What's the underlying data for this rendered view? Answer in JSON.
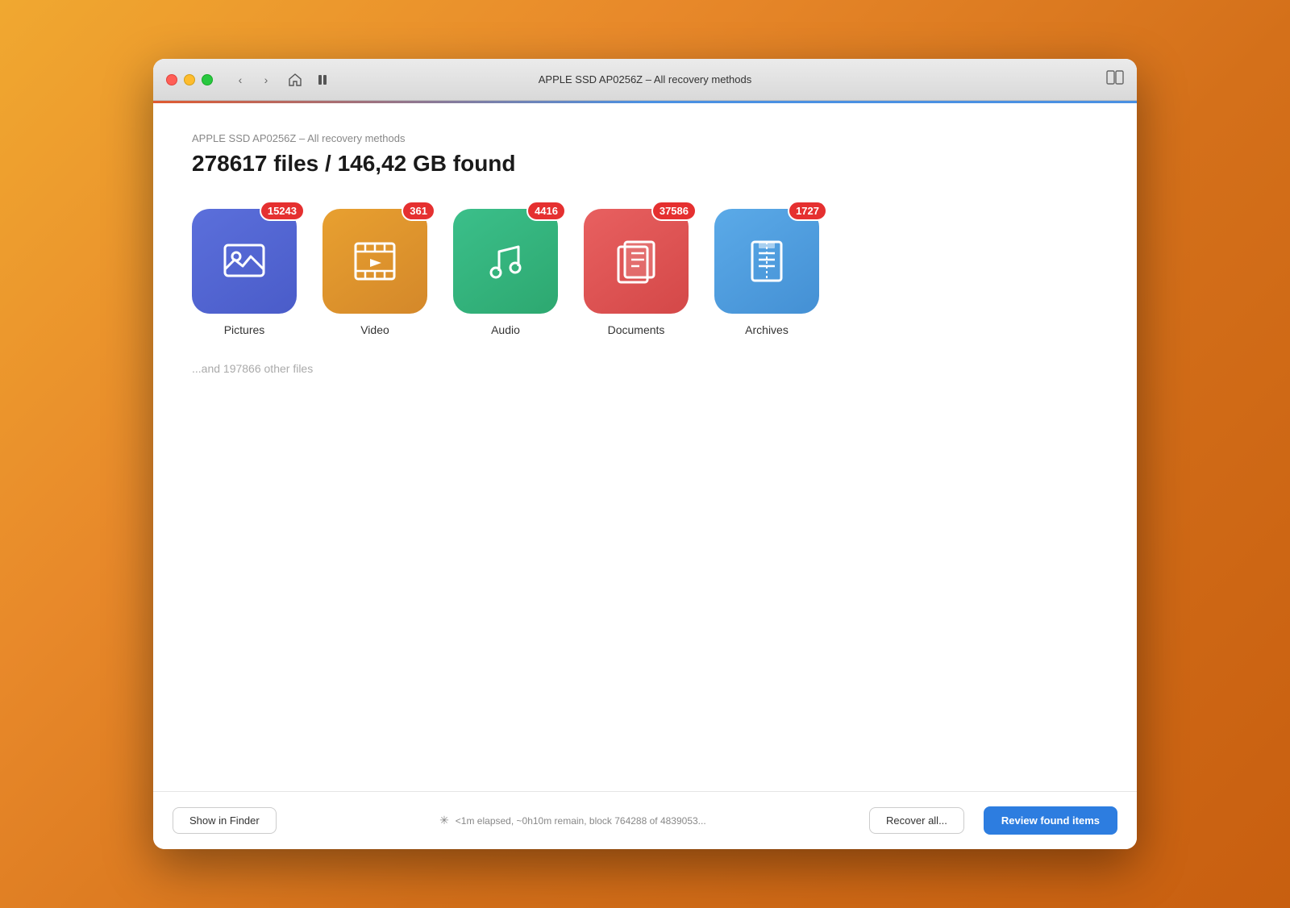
{
  "window": {
    "title": "APPLE SSD AP0256Z – All recovery methods",
    "breadcrumb": "APPLE SSD AP0256Z – All recovery methods",
    "main_title": "278617 files / 146,42 GB found"
  },
  "file_types": [
    {
      "id": "pictures",
      "label": "Pictures",
      "count": "15243",
      "color_class": "pictures"
    },
    {
      "id": "video",
      "label": "Video",
      "count": "361",
      "color_class": "video"
    },
    {
      "id": "audio",
      "label": "Audio",
      "count": "4416",
      "color_class": "audio"
    },
    {
      "id": "documents",
      "label": "Documents",
      "count": "37586",
      "color_class": "documents"
    },
    {
      "id": "archives",
      "label": "Archives",
      "count": "1727",
      "color_class": "archives"
    }
  ],
  "other_files": "...and 197866 other files",
  "bottombar": {
    "show_finder": "Show in Finder",
    "status": "<1m elapsed, ~0h10m remain, block 764288 of 4839053...",
    "recover_all": "Recover all...",
    "review_items": "Review found items"
  }
}
